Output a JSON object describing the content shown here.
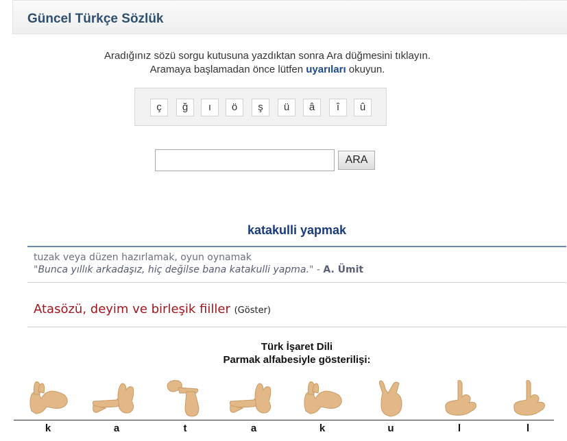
{
  "header": {
    "title": "Güncel Türkçe Sözlük"
  },
  "intro": {
    "line1": "Aradığınız sözü sorgu kutusuna yazdıktan sonra Ara düğmesini tıklayın.",
    "line2_before": "Aramaya başlamadan önce lütfen ",
    "line2_link": "uyarıları",
    "line2_after": " okuyun."
  },
  "keyboard": {
    "keys": [
      "ç",
      "ğ",
      "ı",
      "ö",
      "ş",
      "ü",
      "â",
      "î",
      "û"
    ]
  },
  "search": {
    "value": "",
    "placeholder": "",
    "button_label": "ARA"
  },
  "entry": {
    "headword": "katakulli yapmak",
    "definition": "tuzak veya düzen hazırlamak, oyun oynamak",
    "example_open_quote": "\"",
    "example_text": "Bunca yıllık arkadaşız, hiç değilse bana katakulli yapma.",
    "example_close_quote": "\" - ",
    "example_author": "A. Ümit"
  },
  "phrases": {
    "title": "Atasözü, deyim ve birleşik fiiller",
    "toggle": "(Göster)"
  },
  "sign_language": {
    "title": "Türk İşaret Dili",
    "subtitle": "Parmak alfabesiyle gösterilişi:",
    "letters": [
      "k",
      "a",
      "t",
      "a",
      "k",
      "u",
      "l",
      "l"
    ],
    "hand_shapes": [
      "hand-k-icon",
      "hand-a-icon",
      "hand-t-icon",
      "hand-a-icon",
      "hand-k-icon",
      "hand-u-icon",
      "hand-l-icon",
      "hand-l-icon"
    ]
  },
  "colors": {
    "header_title": "#2f4f6f",
    "headword": "#1a3a7a",
    "phrases_title": "#a0161c",
    "skin": "#e2b887"
  }
}
